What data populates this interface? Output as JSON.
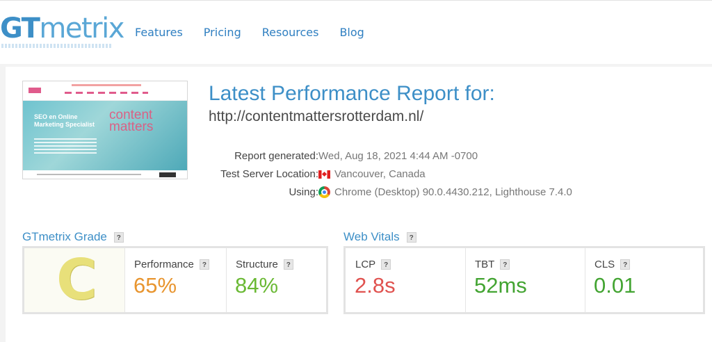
{
  "header": {
    "logo_gt": "GT",
    "logo_metrix": "metrix",
    "nav": [
      "Features",
      "Pricing",
      "Resources",
      "Blog"
    ]
  },
  "thumbnail": {
    "hero_text": "SEO en Online Marketing Specialist",
    "brand_text": "content matters"
  },
  "report": {
    "title": "Latest Performance Report for:",
    "url": "http://contentmattersrotterdam.nl/",
    "rows": [
      {
        "label": "Report generated:",
        "value": "Wed, Aug 18, 2021 4:44 AM -0700",
        "icon": ""
      },
      {
        "label": "Test Server Location:",
        "value": "Vancouver, Canada",
        "icon": "canada-flag-icon"
      },
      {
        "label": "Using:",
        "value": "Chrome (Desktop) 90.0.4430.212, Lighthouse 7.4.0",
        "icon": "chrome-icon"
      }
    ]
  },
  "grade": {
    "section_title": "GTmetrix Grade",
    "help": "?",
    "letter": "C",
    "letter_color": "#e8e07a",
    "metrics": [
      {
        "name": "Performance",
        "value": "65%",
        "color": "#e8952f"
      },
      {
        "name": "Structure",
        "value": "84%",
        "color": "#6ab934"
      }
    ]
  },
  "vitals": {
    "section_title": "Web Vitals",
    "help": "?",
    "metrics": [
      {
        "name": "LCP",
        "value": "2.8s",
        "color": "#e0524f"
      },
      {
        "name": "TBT",
        "value": "52ms",
        "color": "#43a432"
      },
      {
        "name": "CLS",
        "value": "0.01",
        "color": "#43a432"
      }
    ]
  }
}
